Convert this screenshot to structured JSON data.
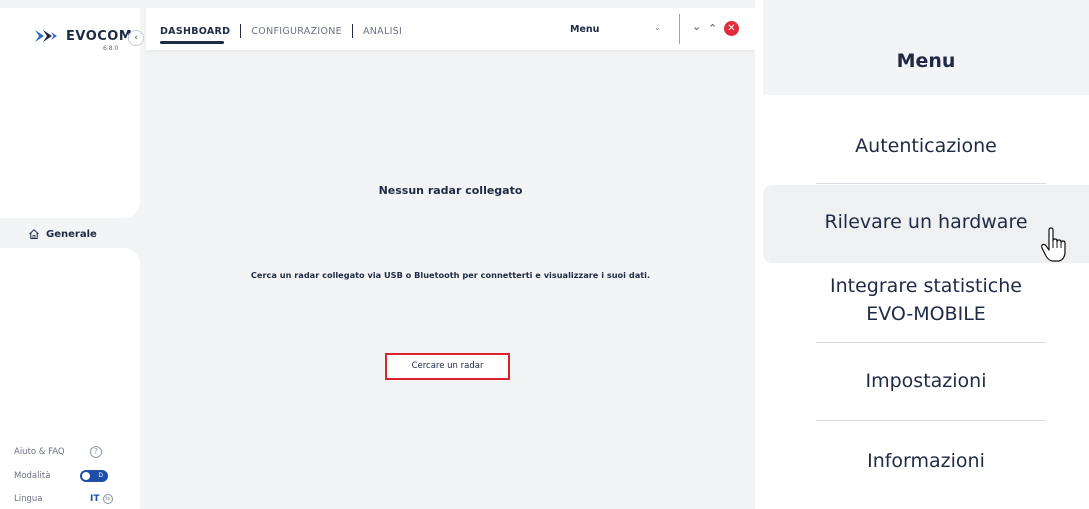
{
  "app": {
    "brand": "EVOCOM",
    "version": "6.8.0",
    "collapse_icon": "chevron-left-icon"
  },
  "sidebar": {
    "nav_items": [
      {
        "label": "Generale",
        "icon": "home-icon"
      }
    ],
    "help_label": "Aiuto & FAQ",
    "mode_label": "Modalità",
    "mode_toggle_text": "D",
    "language_label": "Lingua",
    "language_value": "IT"
  },
  "topbar": {
    "tabs": [
      "DASHBOARD",
      "CONFIGURAZIONE",
      "ANALISI"
    ],
    "menu_select": "Menu"
  },
  "main": {
    "title": "Nessun radar collegato",
    "description": "Cerca un radar collegato via USB o Bluetooth per connetterti e visualizzare i suoi dati.",
    "search_button": "Cercare un radar"
  },
  "menu_panel": {
    "title": "Menu",
    "items": [
      "Autenticazione",
      "Rilevare un hardware",
      "Integrare statistiche EVO-MOBILE",
      "Impostazioni",
      "Informazioni"
    ],
    "hovered_index": 1
  },
  "colors": {
    "brand_dark": "#1f2a44",
    "accent_blue": "#1f4ea8",
    "close_red": "#e02b3a",
    "highlight_red": "#d9232e"
  }
}
